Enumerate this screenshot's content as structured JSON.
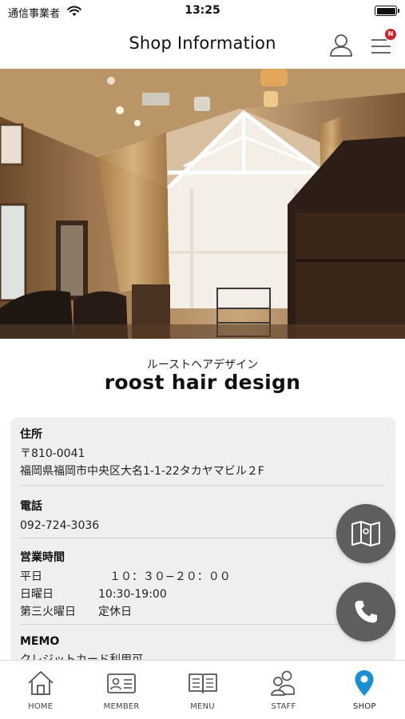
{
  "status_bar": {
    "carrier": "通信事業者",
    "time": "13:25"
  },
  "header": {
    "title": "Shop Information",
    "menu_badge": "N"
  },
  "shop": {
    "name_kana": "ルーストヘアデザイン",
    "name": "roost hair design"
  },
  "info": {
    "address": {
      "label": "住所",
      "postal": "〒810-0041",
      "street": "福岡県福岡市中央区大名1-1-22タカヤマビル２F"
    },
    "phone": {
      "label": "電話",
      "number": "092-724-3036"
    },
    "hours": {
      "label": "営業時間",
      "rows": [
        {
          "day": "平日",
          "time": "　１０：３０−２０：００"
        },
        {
          "day": "日曜日",
          "time": "10:30-19:00"
        },
        {
          "day": "第三火曜日",
          "time": "定休日"
        }
      ]
    },
    "memo": {
      "label": "MEMO",
      "text": "クレジットカード利用可"
    }
  },
  "tabs": [
    {
      "label": "HOME",
      "icon": "home-icon"
    },
    {
      "label": "MEMBER",
      "icon": "member-card-icon"
    },
    {
      "label": "MENU",
      "icon": "book-icon"
    },
    {
      "label": "STAFF",
      "icon": "staff-icon"
    },
    {
      "label": "SHOP",
      "icon": "location-pin-icon"
    }
  ],
  "colors": {
    "accent": "#1a8fd6",
    "fab": "#5e5e5e",
    "badge": "#d0202a",
    "card_bg": "#efefef"
  }
}
